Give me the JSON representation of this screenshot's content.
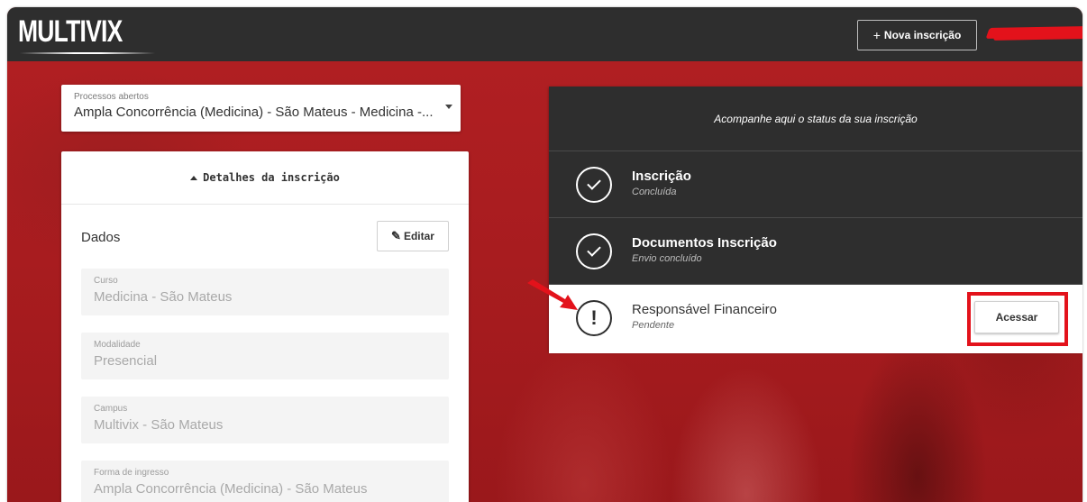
{
  "header": {
    "logo": "MULTIVIX",
    "new_registration_button": "Nova inscrição",
    "plus_icon": "plus-icon"
  },
  "process_select": {
    "caption": "Processos abertos",
    "value": "Ampla Concorrência (Medicina) - São Mateus - Medicina -..."
  },
  "details": {
    "header": "Detalhes da inscrição",
    "section_title": "Dados",
    "edit_button": "Editar",
    "fields": [
      {
        "label": "Curso",
        "value": "Medicina - São Mateus"
      },
      {
        "label": "Modalidade",
        "value": "Presencial"
      },
      {
        "label": "Campus",
        "value": "Multivix - São Mateus"
      },
      {
        "label": "Forma de ingresso",
        "value": "Ampla Concorrência (Medicina) - São Mateus"
      }
    ]
  },
  "status": {
    "header": "Acompanhe aqui o status da sua inscrição",
    "steps": [
      {
        "title": "Inscrição",
        "subtitle": "Concluída",
        "state": "done"
      },
      {
        "title": "Documentos Inscrição",
        "subtitle": "Envio concluído",
        "state": "done"
      },
      {
        "title": "Responsável Financeiro",
        "subtitle": "Pendente",
        "state": "pending",
        "action": "Acessar"
      }
    ]
  },
  "colors": {
    "topbar": "#2e2e2e",
    "background_red": "#a81c1f",
    "annotation_red": "#e3121b"
  }
}
